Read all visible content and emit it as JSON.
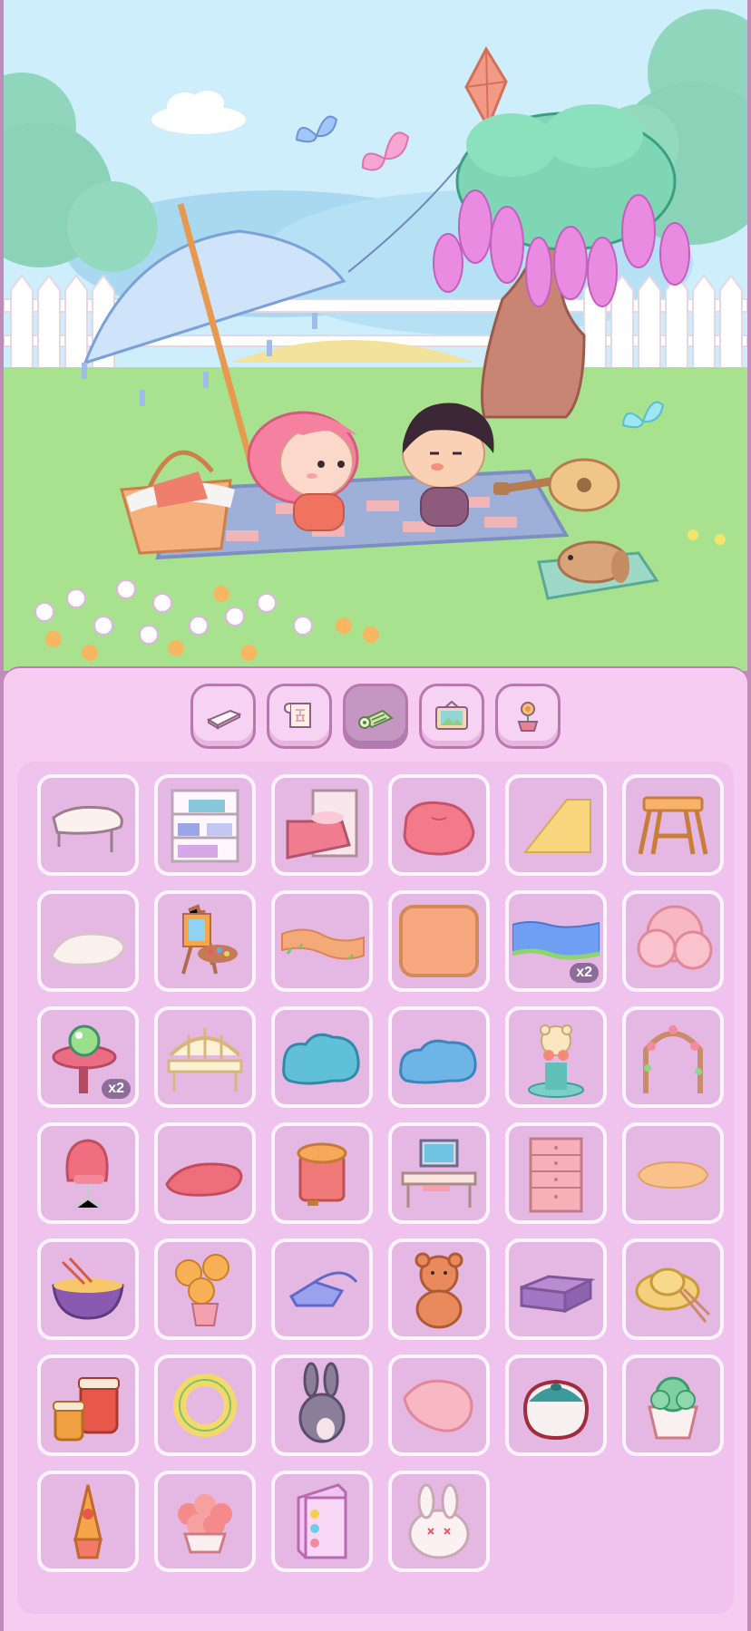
{
  "scene": {
    "characters": [
      "pink-haired-girl",
      "dark-haired-boy"
    ],
    "props": [
      "parasol",
      "picnic-basket",
      "picnic-blanket",
      "guitar",
      "bunny-on-cushion",
      "wisteria-tree",
      "kite",
      "butterflies",
      "white-fence",
      "flowers"
    ]
  },
  "tabs": [
    {
      "name": "tab-floor",
      "icon": "floor-tile-icon",
      "active": false
    },
    {
      "name": "tab-wallpaper",
      "icon": "wallpaper-icon",
      "active": false
    },
    {
      "name": "tab-rugs",
      "icon": "rug-roll-icon",
      "active": true
    },
    {
      "name": "tab-decor",
      "icon": "picture-frame-icon",
      "active": false
    },
    {
      "name": "tab-plants",
      "icon": "flower-pot-icon",
      "active": false
    }
  ],
  "items": [
    {
      "name": "round-table",
      "badge": ""
    },
    {
      "name": "bookshelf",
      "badge": ""
    },
    {
      "name": "pink-bed",
      "badge": ""
    },
    {
      "name": "bean-bag",
      "badge": ""
    },
    {
      "name": "yellow-rug",
      "badge": ""
    },
    {
      "name": "picnic-table",
      "badge": ""
    },
    {
      "name": "white-fluffy-rug",
      "badge": ""
    },
    {
      "name": "painting-easel",
      "badge": ""
    },
    {
      "name": "dirt-path",
      "badge": ""
    },
    {
      "name": "orange-rug",
      "badge": ""
    },
    {
      "name": "water-pond",
      "badge": "x2"
    },
    {
      "name": "pink-tree",
      "badge": ""
    },
    {
      "name": "crystal-ball-table",
      "badge": "x2"
    },
    {
      "name": "garden-bench",
      "badge": ""
    },
    {
      "name": "blue-bush",
      "badge": ""
    },
    {
      "name": "blue-hedge",
      "badge": ""
    },
    {
      "name": "bear-fountain",
      "badge": ""
    },
    {
      "name": "flower-arch",
      "badge": ""
    },
    {
      "name": "egg-chair",
      "badge": ""
    },
    {
      "name": "pink-shaggy-rug",
      "badge": ""
    },
    {
      "name": "trash-bin",
      "badge": ""
    },
    {
      "name": "computer-desk",
      "badge": ""
    },
    {
      "name": "pink-drawers",
      "badge": ""
    },
    {
      "name": "peach-flower-rug",
      "badge": ""
    },
    {
      "name": "noodle-bowl",
      "badge": ""
    },
    {
      "name": "sunflower-vase",
      "badge": ""
    },
    {
      "name": "blue-pouch",
      "badge": ""
    },
    {
      "name": "teddy-bear",
      "badge": ""
    },
    {
      "name": "purple-box",
      "badge": ""
    },
    {
      "name": "straw-hat",
      "badge": ""
    },
    {
      "name": "jam-jars",
      "badge": ""
    },
    {
      "name": "flower-wreath",
      "badge": ""
    },
    {
      "name": "grey-bunny",
      "badge": ""
    },
    {
      "name": "pink-blanket",
      "badge": ""
    },
    {
      "name": "rice-cooker",
      "badge": ""
    },
    {
      "name": "succulent-pot",
      "badge": ""
    },
    {
      "name": "lava-lamp",
      "badge": ""
    },
    {
      "name": "coral-flower-pot",
      "badge": ""
    },
    {
      "name": "glass-display-case",
      "badge": ""
    },
    {
      "name": "white-bunny-plush",
      "badge": ""
    }
  ],
  "colors": {
    "panel_bg": "#f7ccf3",
    "grid_bg": "#efc3ed",
    "slot_bg": "#e5b8e3",
    "slot_border": "#fdf4fd",
    "tab_border": "#b678ad",
    "tab_active": "#c596c2",
    "badge_bg": "#8c6c9a"
  }
}
